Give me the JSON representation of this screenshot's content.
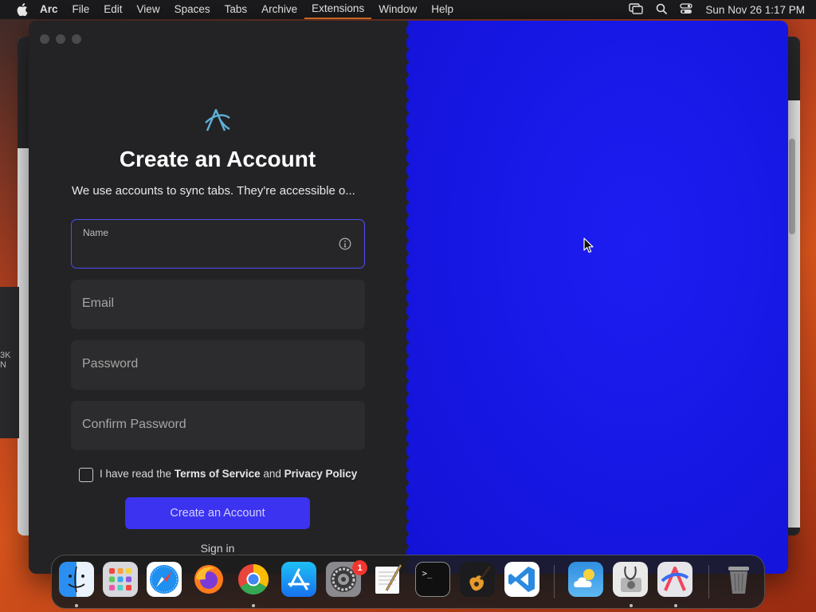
{
  "menubar": {
    "app_name": "Arc",
    "items": [
      "File",
      "Edit",
      "View",
      "Spaces",
      "Tabs",
      "Archive",
      "Extensions",
      "Window",
      "Help"
    ],
    "active_item": "Extensions",
    "status_icons": [
      "screen-mirroring-icon",
      "spotlight-search-icon",
      "control-center-icon"
    ],
    "clock": "Sun Nov 26  1:17 PM"
  },
  "background": {
    "left_window_truncated_text": "3K N"
  },
  "arc_window": {
    "title": "Create an Account",
    "subtitle": "We use accounts to sync tabs. They're accessible o...",
    "fields": {
      "name": {
        "label": "Name",
        "value": ""
      },
      "email": {
        "placeholder": "Email"
      },
      "password": {
        "placeholder": "Password"
      },
      "confirm_password": {
        "placeholder": "Confirm Password"
      }
    },
    "terms": {
      "prefix": "I have read the ",
      "tos": "Terms of Service",
      "middle": " and ",
      "privacy": "Privacy Policy",
      "checked": false
    },
    "create_button": "Create an Account",
    "sign_in": "Sign in",
    "accent_color": "#3b33f0",
    "right_panel_color": "#1818e6"
  },
  "dock": {
    "apps": [
      {
        "name": "Finder",
        "icon": "finder-icon",
        "running": true
      },
      {
        "name": "Launchpad",
        "icon": "launchpad-icon",
        "running": false
      },
      {
        "name": "Safari",
        "icon": "safari-icon",
        "running": false
      },
      {
        "name": "Firefox",
        "icon": "firefox-icon",
        "running": false
      },
      {
        "name": "Chrome",
        "icon": "chrome-icon",
        "running": true
      },
      {
        "name": "App Store",
        "icon": "app-store-icon",
        "running": false
      },
      {
        "name": "System Settings",
        "icon": "system-settings-icon",
        "running": false,
        "badge": "1"
      },
      {
        "name": "TextEdit",
        "icon": "textedit-icon",
        "running": false
      },
      {
        "name": "Terminal",
        "icon": "terminal-icon",
        "running": false
      },
      {
        "name": "GarageBand",
        "icon": "garageband-icon",
        "running": false
      },
      {
        "name": "VS Code",
        "icon": "vscode-icon",
        "running": false
      },
      {
        "name": "Weather",
        "icon": "weather-icon",
        "running": false
      },
      {
        "name": "Disk Utility",
        "icon": "disk-utility-icon",
        "running": true
      },
      {
        "name": "Arc",
        "icon": "arc-icon",
        "running": true
      },
      {
        "name": "Trash",
        "icon": "trash-icon",
        "running": false
      }
    ]
  }
}
